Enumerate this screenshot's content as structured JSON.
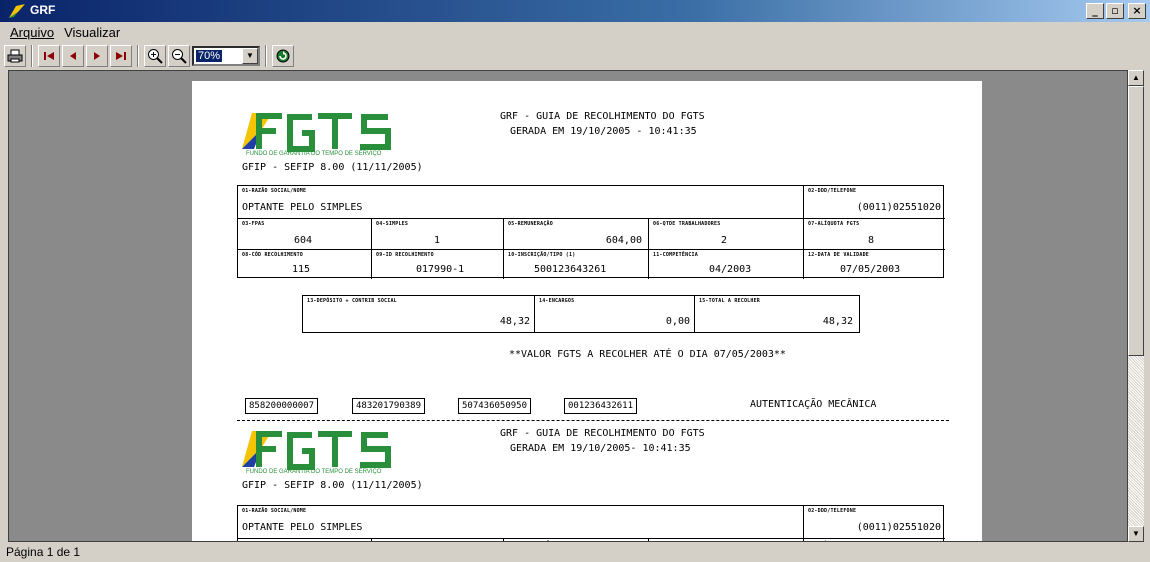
{
  "window": {
    "title": "GRF"
  },
  "menu": {
    "items": [
      {
        "label": "Arquivo"
      },
      {
        "label": "Visualizar"
      }
    ]
  },
  "toolbar": {
    "zoom_value": "70%",
    "buttons": [
      "print-icon",
      "first-page-icon",
      "prev-page-icon",
      "next-page-icon",
      "last-page-icon",
      "zoom-in-icon",
      "zoom-out-icon",
      "exit-icon"
    ]
  },
  "status": {
    "text": "Página 1 de 1"
  },
  "document": {
    "logo_text": "FGTS",
    "logo_subtext": "FUNDO DE GARANTIA DO TEMPO DE SERVIÇO",
    "gfip_line": "GFIP - SEFIP 8.00 (11/11/2005)",
    "header_line1": "GRF - GUIA DE RECOLHIMENTO DO FGTS",
    "header_line2": "GERADA EM 19/10/2005 - 10:41:35",
    "header_line2b": "GERADA EM  19/10/2005- 10:41:35",
    "labels": {
      "razao": "01-RAZÃO SOCIAL/NOME",
      "ddd": "02-DDD/TELEFONE",
      "fpas": "03-FPAS",
      "simples": "04-SIMPLES",
      "remuneracao": "05-REMUNERAÇÃO",
      "qtde": "06-QTDE TRABALHADORES",
      "aliquota": "07-ALÍQUOTA FGTS",
      "cod_recolhimento": "08-CÓD RECOLHIMENTO",
      "id_recolhimento": "09-ID RECOLHIMENTO",
      "inscricao": "10-INSCRIÇÃO/TIPO (1)",
      "competencia": "11-COMPETÊNCIA",
      "validade": "12-DATA DE VALIDADE",
      "deposito": "13-DEPÓSITO + CONTRIB SOCIAL",
      "encargos": "14-ENCARGOS",
      "total": "15-TOTAL A RECOLHER"
    },
    "values": {
      "razao": "OPTANTE PELO SIMPLES",
      "ddd": "(0011)02551020",
      "fpas": "604",
      "simples": "1",
      "remuneracao": "604,00",
      "qtde": "2",
      "aliquota": "8",
      "cod_recolhimento": "115",
      "id_recolhimento": "017990-1",
      "inscricao": "500123643261",
      "competencia": "04/2003",
      "validade": "07/05/2003",
      "deposito": "48,32",
      "encargos": "0,00",
      "total": "48,32"
    },
    "valor_note": "**VALOR FGTS A RECOLHER ATÉ O DIA 07/05/2003**",
    "barcodes": [
      "858200000007",
      "483201790389",
      "507436050950",
      "001236432611"
    ],
    "autenticacao": "AUTENTICAÇÃO MECÂNICA"
  },
  "colors": {
    "titlebar": "#0a246a",
    "fgts_green": "#2a8f3a",
    "fgts_yellow": "#f5c400",
    "fgts_blue": "#1f3fa3"
  }
}
